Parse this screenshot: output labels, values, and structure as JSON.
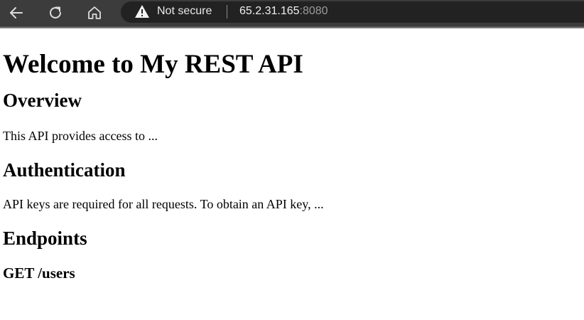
{
  "browser": {
    "security_status": "Not secure",
    "url_host": "65.2.31.165",
    "url_port": ":8080",
    "icons": {
      "back": "back-arrow-icon",
      "reload": "reload-icon",
      "home": "home-icon",
      "warning": "warning-triangle-icon"
    },
    "colors": {
      "toolbar": "#3c3c3c",
      "omnibox": "#222222",
      "text": "#e8e8e8",
      "port_text": "#9a9a9a"
    }
  },
  "page": {
    "title": "Welcome to My REST API",
    "sections": [
      {
        "heading": "Overview",
        "body": "This API provides access to ..."
      },
      {
        "heading": "Authentication",
        "body": "API keys are required for all requests. To obtain an API key, ..."
      },
      {
        "heading": "Endpoints",
        "subheading": "GET /users"
      }
    ]
  }
}
